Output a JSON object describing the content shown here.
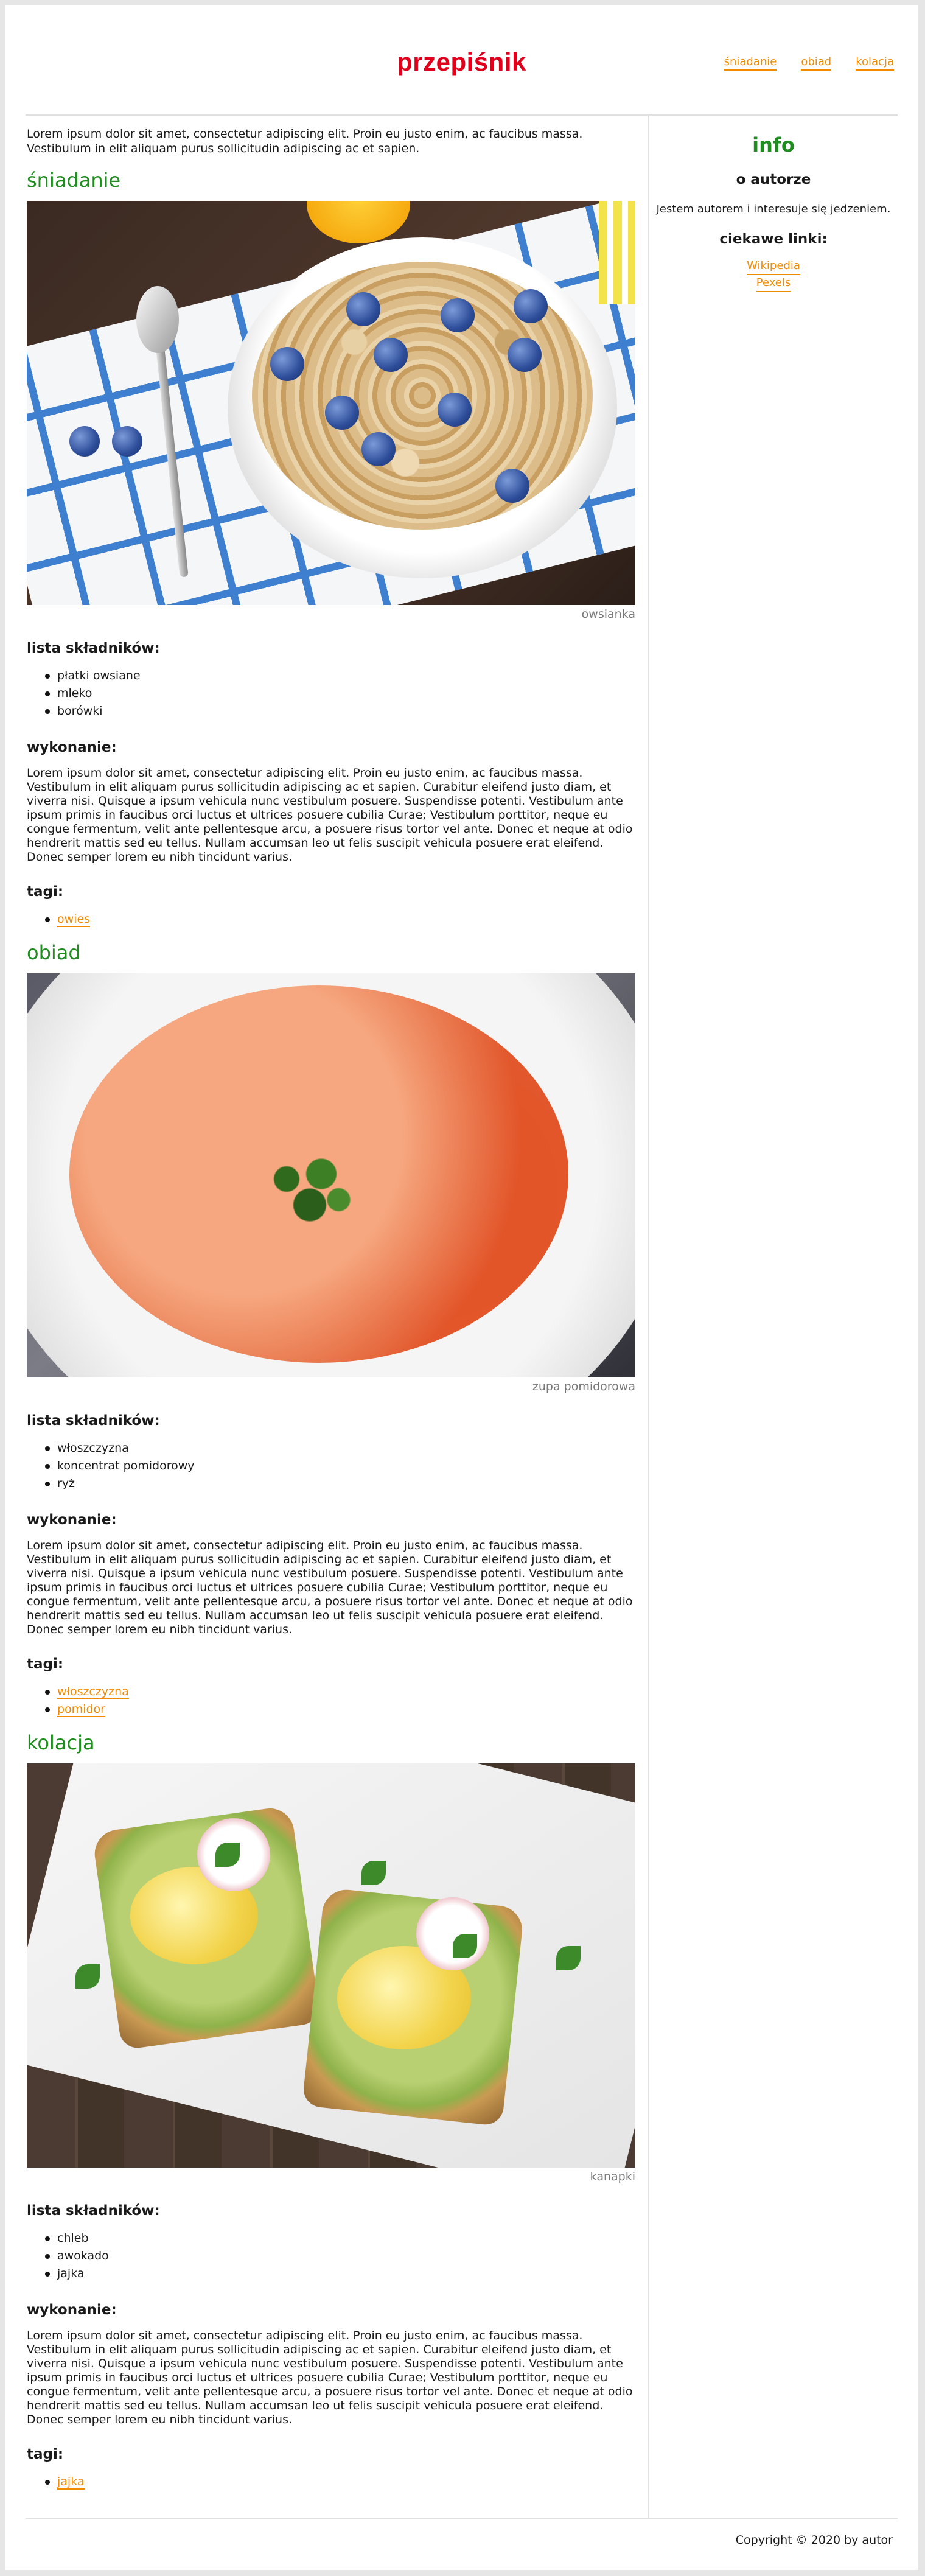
{
  "header": {
    "logo": "przepiśnik",
    "nav": [
      "śniadanie",
      "obiad",
      "kolacja"
    ]
  },
  "intro": "Lorem ipsum dolor sit amet, consectetur adipiscing elit. Proin eu justo enim, ac faucibus massa. Vestibulum in elit aliquam purus sollicitudin adipiscing ac et sapien.",
  "labels": {
    "ingredients": "lista składników:",
    "method": "wykonanie:",
    "tags": "tagi:"
  },
  "recipes": [
    {
      "title": "śniadanie",
      "caption": "owsianka",
      "ingredients": [
        "płatki owsiane",
        "mleko",
        "borówki"
      ],
      "method": "Lorem ipsum dolor sit amet, consectetur adipiscing elit. Proin eu justo enim, ac faucibus massa. Vestibulum in elit aliquam purus sollicitudin adipiscing ac et sapien. Curabitur eleifend justo diam, et viverra nisi. Quisque a ipsum vehicula nunc vestibulum posuere. Suspendisse potenti. Vestibulum ante ipsum primis in faucibus orci luctus et ultrices posuere cubilia Curae; Vestibulum porttitor, neque eu congue fermentum, velit ante pellentesque arcu, a posuere risus tortor vel ante. Donec et neque at odio hendrerit mattis sed eu tellus. Nullam accumsan leo ut felis suscipit vehicula posuere erat eleifend. Donec semper lorem eu nibh tincidunt varius.",
      "tags": [
        "owies"
      ]
    },
    {
      "title": "obiad",
      "caption": "zupa pomidorowa",
      "ingredients": [
        "włoszczyzna",
        "koncentrat pomidorowy",
        "ryż"
      ],
      "method": "Lorem ipsum dolor sit amet, consectetur adipiscing elit. Proin eu justo enim, ac faucibus massa. Vestibulum in elit aliquam purus sollicitudin adipiscing ac et sapien. Curabitur eleifend justo diam, et viverra nisi. Quisque a ipsum vehicula nunc vestibulum posuere. Suspendisse potenti. Vestibulum ante ipsum primis in faucibus orci luctus et ultrices posuere cubilia Curae; Vestibulum porttitor, neque eu congue fermentum, velit ante pellentesque arcu, a posuere risus tortor vel ante. Donec et neque at odio hendrerit mattis sed eu tellus. Nullam accumsan leo ut felis suscipit vehicula posuere erat eleifend. Donec semper lorem eu nibh tincidunt varius.",
      "tags": [
        "włoszczyzna",
        "pomidor"
      ]
    },
    {
      "title": "kolacja",
      "caption": "kanapki",
      "ingredients": [
        "chleb",
        "awokado",
        "jajka"
      ],
      "method": "Lorem ipsum dolor sit amet, consectetur adipiscing elit. Proin eu justo enim, ac faucibus massa. Vestibulum in elit aliquam purus sollicitudin adipiscing ac et sapien. Curabitur eleifend justo diam, et viverra nisi. Quisque a ipsum vehicula nunc vestibulum posuere. Suspendisse potenti. Vestibulum ante ipsum primis in faucibus orci luctus et ultrices posuere cubilia Curae; Vestibulum porttitor, neque eu congue fermentum, velit ante pellentesque arcu, a posuere risus tortor vel ante. Donec et neque at odio hendrerit mattis sed eu tellus. Nullam accumsan leo ut felis suscipit vehicula posuere erat eleifend. Donec semper lorem eu nibh tincidunt varius.",
      "tags": [
        "jajka"
      ]
    }
  ],
  "sidebar": {
    "title": "info",
    "about_title": "o autorze",
    "about_text": "Jestem autorem i interesuje się jedzeniem.",
    "links_title": "ciekawe linki:",
    "links": [
      "Wikipedia",
      "Pexels"
    ]
  },
  "footer": "Copyright © 2020 by autor",
  "colors": {
    "logo": "#e0001b",
    "heading": "#1e8c1e",
    "link": "#f28a00"
  }
}
